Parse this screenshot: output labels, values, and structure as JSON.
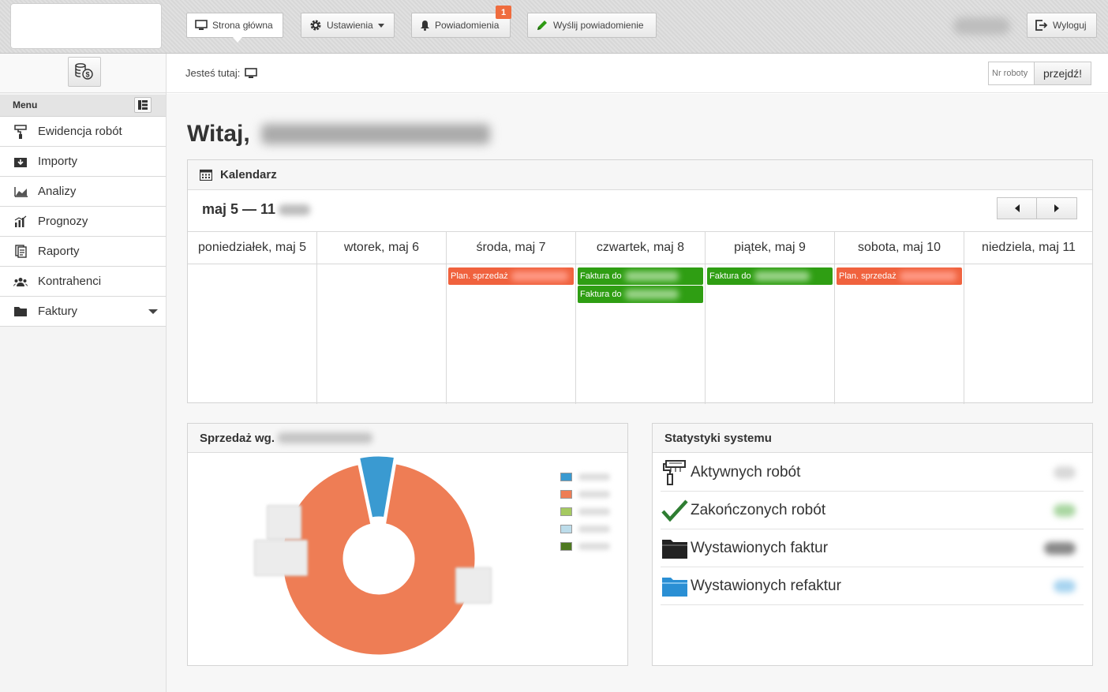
{
  "topbar": {
    "home_label": "Strona główna",
    "settings_label": "Ustawienia",
    "notifications_label": "Powiadomienia",
    "notifications_count": "1",
    "send_notification_label": "Wyślij powiadomienie",
    "logout_label": "Wyloguj"
  },
  "breadcrumb": {
    "label": "Jesteś tutaj:"
  },
  "jump": {
    "placeholder": "Nr roboty",
    "button_label": "przejdź!"
  },
  "sidebar": {
    "menu_label": "Menu",
    "items": [
      {
        "label": "Ewidencja robót",
        "icon": "roller-icon"
      },
      {
        "label": "Importy",
        "icon": "import-icon"
      },
      {
        "label": "Analizy",
        "icon": "area-chart-icon"
      },
      {
        "label": "Prognozy",
        "icon": "bar-chart-icon"
      },
      {
        "label": "Raporty",
        "icon": "report-icon"
      },
      {
        "label": "Kontrahenci",
        "icon": "users-icon"
      },
      {
        "label": "Faktury",
        "icon": "folder-icon"
      }
    ]
  },
  "main": {
    "welcome": "Witaj,"
  },
  "calendar": {
    "title": "Kalendarz",
    "range": "maj 5 — 11",
    "days": [
      "poniedziałek, maj 5",
      "wtorek, maj 6",
      "środa, maj 7",
      "czwartek, maj 8",
      "piątek, maj 9",
      "sobota, maj 10",
      "niedziela, maj 11"
    ],
    "events": {
      "wed_1": "Plan. sprzedaż",
      "thu_1": "Faktura do",
      "thu_2": "Faktura do",
      "fri_1": "Faktura do",
      "sat_1": "Plan. sprzedaż"
    }
  },
  "sales": {
    "title": "Sprzedaż wg."
  },
  "stats": {
    "title": "Statystyki systemu",
    "rows": [
      {
        "label": "Aktywnych robót",
        "icon": "roller-icon"
      },
      {
        "label": "Zakończonych robót",
        "icon": "checkmark-icon"
      },
      {
        "label": "Wystawionych faktur",
        "icon": "folder-icon"
      },
      {
        "label": "Wystawionych refaktur",
        "icon": "folder-open-icon"
      }
    ]
  },
  "chart_data": {
    "type": "pie",
    "donut": true,
    "title": "",
    "slices": [
      {
        "value": 6,
        "color": "#3a9ad1"
      },
      {
        "value": 94,
        "color": "#ee7d55"
      },
      {
        "value": 0,
        "color": "#a5c960"
      },
      {
        "value": 0,
        "color": "#bcdcea"
      },
      {
        "value": 0,
        "color": "#4f7a21"
      }
    ]
  },
  "colors": {
    "accent_orange": "#ef6c3e",
    "event_red": "#f0623e",
    "event_green": "#2f9e13",
    "check_green": "#2e7d32",
    "folder_blue": "#2a8fd4"
  }
}
